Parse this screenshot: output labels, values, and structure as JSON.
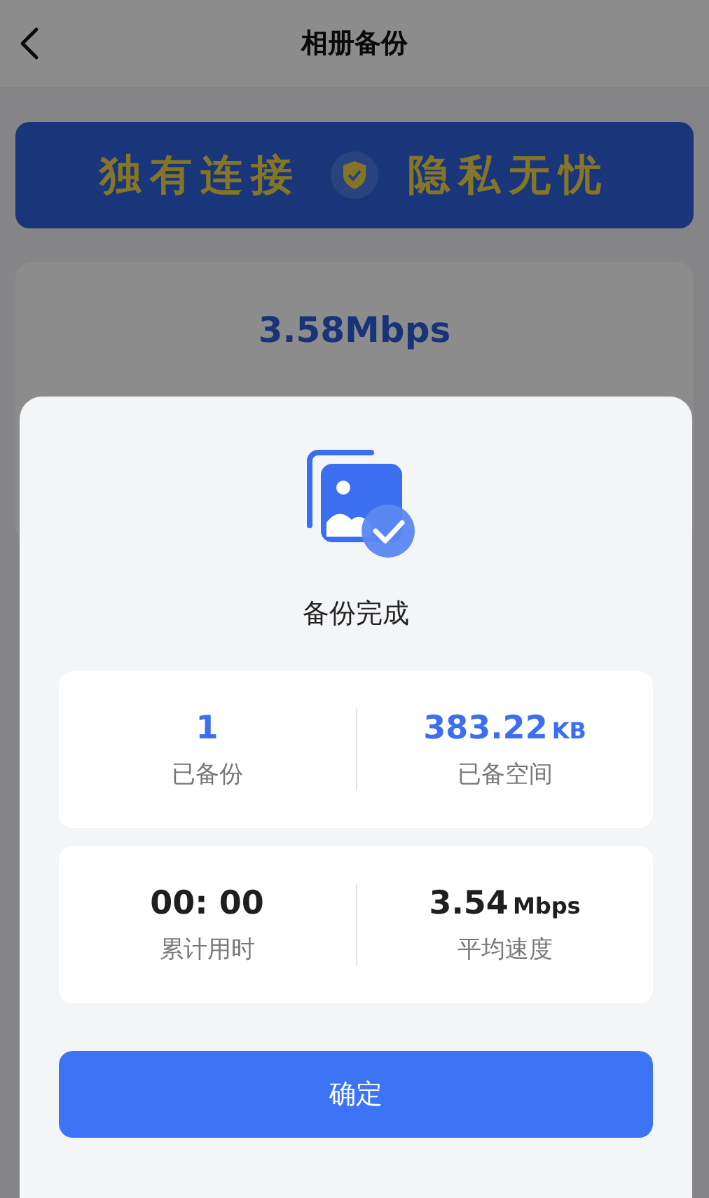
{
  "header": {
    "title": "相册备份"
  },
  "banner": {
    "left": "独有连接",
    "right": "隐私无忧"
  },
  "status_card": {
    "speed": "3.58Mbps"
  },
  "dialog": {
    "title": "备份完成",
    "stat_cards": [
      {
        "stats": [
          {
            "value": "1",
            "label": "已备份",
            "color": "#3b6ff0"
          },
          {
            "value": "383.22",
            "unit": "KB",
            "label": "已备空间",
            "color": "#3b6ff0"
          }
        ]
      },
      {
        "stats": [
          {
            "value": "00: 00",
            "label": "累计用时",
            "color": "#1f1f1f"
          },
          {
            "value": "3.54",
            "unit": "Mbps",
            "label": "平均速度",
            "color": "#1f1f1f"
          }
        ]
      }
    ],
    "confirm": "确定"
  }
}
